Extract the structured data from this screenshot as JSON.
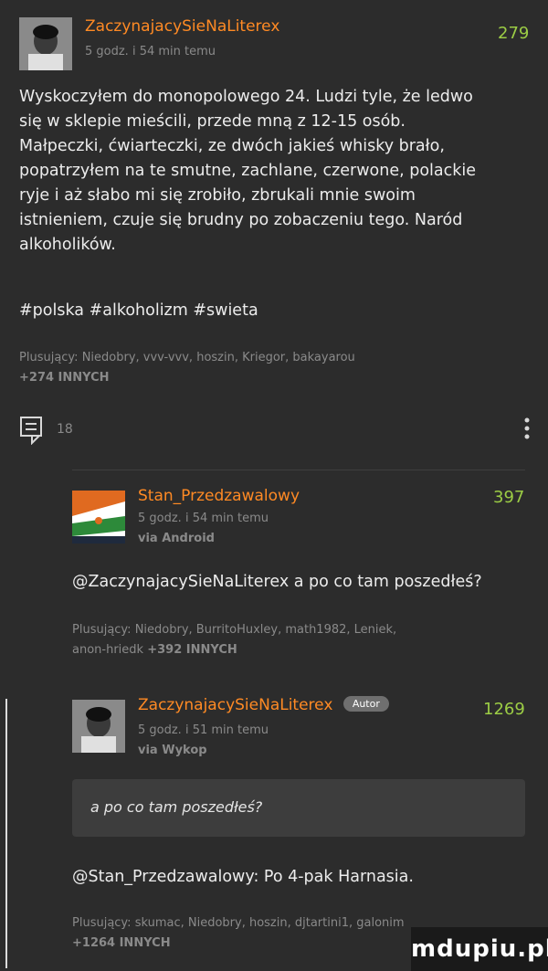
{
  "comment_main": {
    "username": "ZaczynajacySieNaLiterex",
    "score": "279",
    "meta": "5 godz. i 54 min temu",
    "body_lines": [
      "Wyskoczyłem do monopolowego 24. Ludzi tyle, że ledwo",
      "się w sklepie mieścili, przede mną z 12-15 osób.",
      "Małpeczki, ćwiarteczki, ze dwóch jakieś whisky brało,",
      "popatrzyłem na te smutne, zachlane, czerwone, polackie",
      "ryje i aż słabo mi się zrobiło, zbrukali mnie swoim",
      "istnieniem, czuje się brudny po zobaczeniu tego. Naród",
      "alkoholików."
    ],
    "tags": "#polska #alkoholizm #swieta",
    "plus_label": "Plusujący: Niedobry, vvv-vvv, hoszin, Kriegor, bakayarou",
    "plus_more": "+274 INNYCH",
    "reply_count": "18"
  },
  "reply_1": {
    "username": "Stan_Przedzawalowy",
    "score": "397",
    "meta": "5 godz. i 54 min temu",
    "via": "via Android",
    "body": "@ZaczynajacySieNaLiterex a po co tam poszedłeś?",
    "plus_line1": "Plusujący: Niedobry, BurritoHuxley, math1982, Leniek,",
    "plus_line2": "anon-hriedk",
    "plus_more": "+392 INNYCH"
  },
  "reply_2": {
    "username": "ZaczynajacySieNaLiterex",
    "badge": "Autor",
    "score": "1269",
    "meta": "5 godz. i 51 min temu",
    "via": "via Wykop",
    "quote": "a po co tam poszedłeś?",
    "body": "@Stan_Przedzawalowy: Po 4-pak Harnasia.",
    "plus_label": "Plusujący: skumac, Niedobry, hoszin, djtartini1, galonim",
    "plus_more": "+1264 INNYCH"
  },
  "watermark": "mdupiu.pl"
}
